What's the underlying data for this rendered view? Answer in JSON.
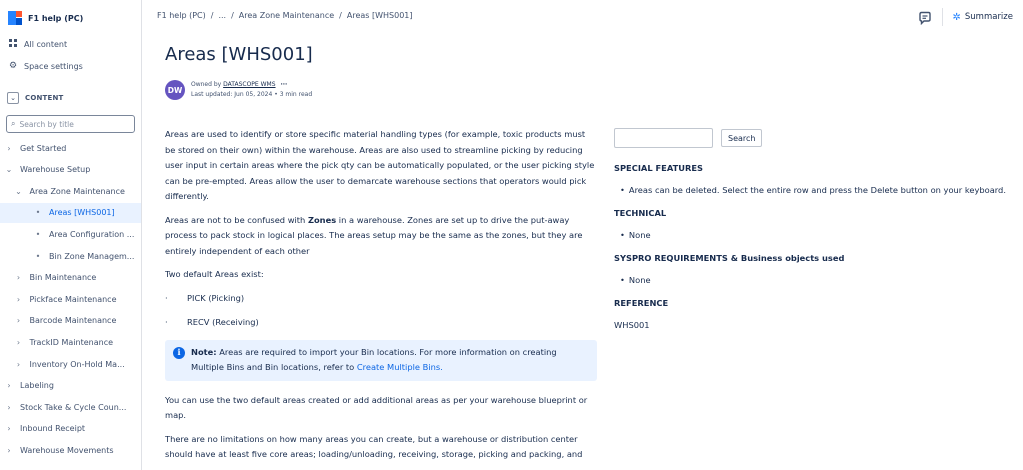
{
  "sidebar": {
    "space_name": "F1 help (PC)",
    "links": [
      {
        "label": "All content",
        "icon": "grid-icon"
      },
      {
        "label": "Space settings",
        "icon": "gear-icon"
      }
    ],
    "content_label": "CONTENT",
    "search_placeholder": "Search by title",
    "tree": [
      {
        "label": "Get Started",
        "level": 0,
        "marker": "›",
        "active": false
      },
      {
        "label": "Warehouse Setup",
        "level": 0,
        "marker": "⌄",
        "active": false
      },
      {
        "label": "Area Zone Maintenance",
        "level": 1,
        "marker": "⌄",
        "active": false
      },
      {
        "label": "Areas [WHS001]",
        "level": 2,
        "marker": "•",
        "active": true
      },
      {
        "label": "Area Configuration ...",
        "level": 2,
        "marker": "•",
        "active": false
      },
      {
        "label": "Bin Zone Managem...",
        "level": 2,
        "marker": "•",
        "active": false
      },
      {
        "label": "Bin Maintenance",
        "level": 1,
        "marker": "›",
        "active": false
      },
      {
        "label": "Pickface Maintenance",
        "level": 1,
        "marker": "›",
        "active": false
      },
      {
        "label": "Barcode Maintenance",
        "level": 1,
        "marker": "›",
        "active": false
      },
      {
        "label": "TrackID Maintenance",
        "level": 1,
        "marker": "›",
        "active": false
      },
      {
        "label": "Inventory On-Hold Ma...",
        "level": 1,
        "marker": "›",
        "active": false
      },
      {
        "label": "Labeling",
        "level": 0,
        "marker": "›",
        "active": false
      },
      {
        "label": "Stock Take & Cycle Coun...",
        "level": 0,
        "marker": "›",
        "active": false
      },
      {
        "label": "Inbound Receipt",
        "level": 0,
        "marker": "›",
        "active": false
      },
      {
        "label": "Warehouse Movements",
        "level": 0,
        "marker": "›",
        "active": false
      }
    ]
  },
  "topbar": {
    "breadcrumb": [
      "F1 help (PC)",
      "/",
      "...",
      "/",
      "Area Zone Maintenance",
      "/",
      "Areas [WHS001]"
    ],
    "summarize_label": "Summarize"
  },
  "page": {
    "title": "Areas [WHS001]",
    "avatar_initials": "DW",
    "owned_by_prefix": "Owned by ",
    "owner": "DATASCOPE WMS",
    "more": "···",
    "last_updated": "Last updated: Jun 05, 2024",
    "separator": "•",
    "read_time": "3 min read"
  },
  "body": {
    "p1": "Areas are used to identify or store specific material handling types (for example, toxic products must be stored on their own) within the warehouse. Areas are also used to streamline picking by reducing user input in certain areas where the pick qty can be automatically populated, or the user picking style can be pre-empted. Areas allow the user to demarcate warehouse sections that operators would pick differently.",
    "p2_a": "Areas are not to be confused with ",
    "p2_bold": "Zones",
    "p2_b": " in a warehouse. Zones are set up to drive the put-away process to pack stock in logical places. The areas setup may be the same as the zones, but they are entirely independent of each other",
    "p3": "Two default Areas exist:",
    "bullets": [
      "PICK (Picking)",
      "RECV (Receiving)"
    ],
    "bullet_mark": "·",
    "note_bold": "Note:",
    "note_text": " Areas are required to import your Bin locations. For more information on creating Multiple Bins and Bin locations, refer to ",
    "note_link": "Create Multiple Bins.",
    "p4": "You can use the two default areas created or add additional areas as per your warehouse blueprint or map.",
    "p5": "There are no limitations on how many areas you can create, but a warehouse or distribution center should have at least five core areas; loading/unloading, receiving, storage, picking and packing, and"
  },
  "right": {
    "search_button": "Search",
    "sections": [
      {
        "heading": "SPECIAL FEATURES",
        "items": [
          "Areas can be deleted. Select the entire row and press the Delete button on your keyboard."
        ]
      },
      {
        "heading": "TECHNICAL",
        "items": [
          "None"
        ]
      },
      {
        "heading": "SYSPRO REQUIREMENTS & Business objects used",
        "items": [
          "None"
        ]
      }
    ],
    "reference_heading": "REFERENCE",
    "reference_value": "WHS001"
  }
}
